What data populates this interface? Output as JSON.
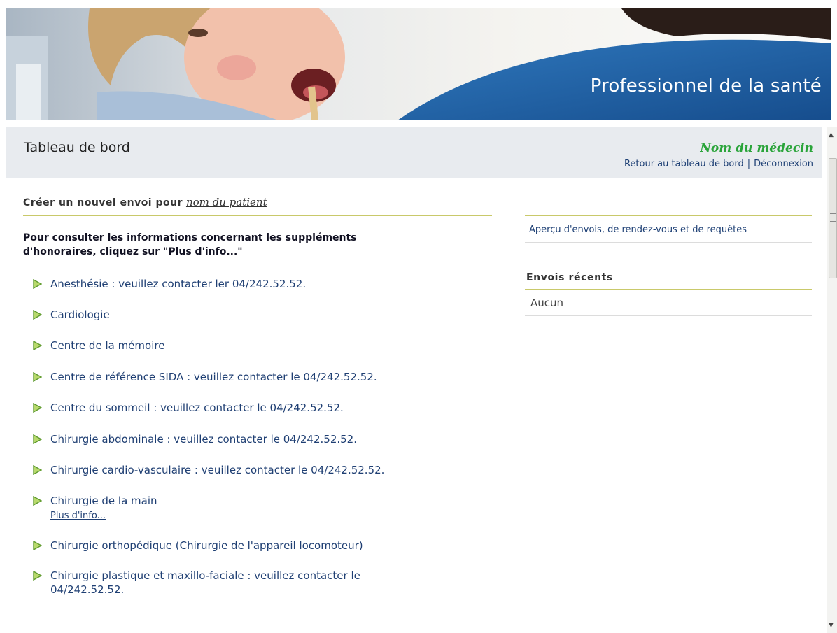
{
  "banner": {
    "title": "Professionnel de la santé"
  },
  "header": {
    "page_title": "Tableau de bord",
    "doctor_name": "Nom du médecin",
    "back_link": "Retour au tableau de bord",
    "separator": "|",
    "logout_link": "Déconnexion"
  },
  "main": {
    "create_label": "Créer un nouvel envoi pour",
    "patient_name": "nom du patient",
    "info_text": "Pour consulter les informations concernant les suppléments d'honoraires, cliquez sur \"Plus d'info...\"",
    "specialties": [
      {
        "label": "Anesthésie : veuillez contacter ler 04/242.52.52."
      },
      {
        "label": "Cardiologie"
      },
      {
        "label": "Centre de la mémoire"
      },
      {
        "label": "Centre de référence SIDA : veuillez contacter le 04/242.52.52."
      },
      {
        "label": "Centre du sommeil : veuillez contacter le 04/242.52.52."
      },
      {
        "label": "Chirurgie abdominale : veuillez contacter le 04/242.52.52."
      },
      {
        "label": "Chirurgie cardio-vasculaire : veuillez contacter le 04/242.52.52."
      },
      {
        "label": "Chirurgie de la main",
        "more": "Plus d'info..."
      },
      {
        "label": "Chirurgie orthopédique (Chirurgie de l'appareil locomoteur)"
      },
      {
        "label": "Chirurgie plastique et maxillo-faciale : veuillez contacter le 04/242.52.52."
      }
    ]
  },
  "sidebar": {
    "overview_link": "Aperçu d'envois, de rendez-vous et de requêtes",
    "recent_title": "Envois récents",
    "recent_none": "Aucun"
  },
  "colors": {
    "link": "#1d3f74",
    "doctor_name": "#2aa43a",
    "divider": "#c9c96a",
    "header_bg": "#e8ebef",
    "banner_blue": "#1f5c9e",
    "arrow": "#6ab04c"
  },
  "icons": {
    "list_bullet": "green-arrow-icon"
  }
}
